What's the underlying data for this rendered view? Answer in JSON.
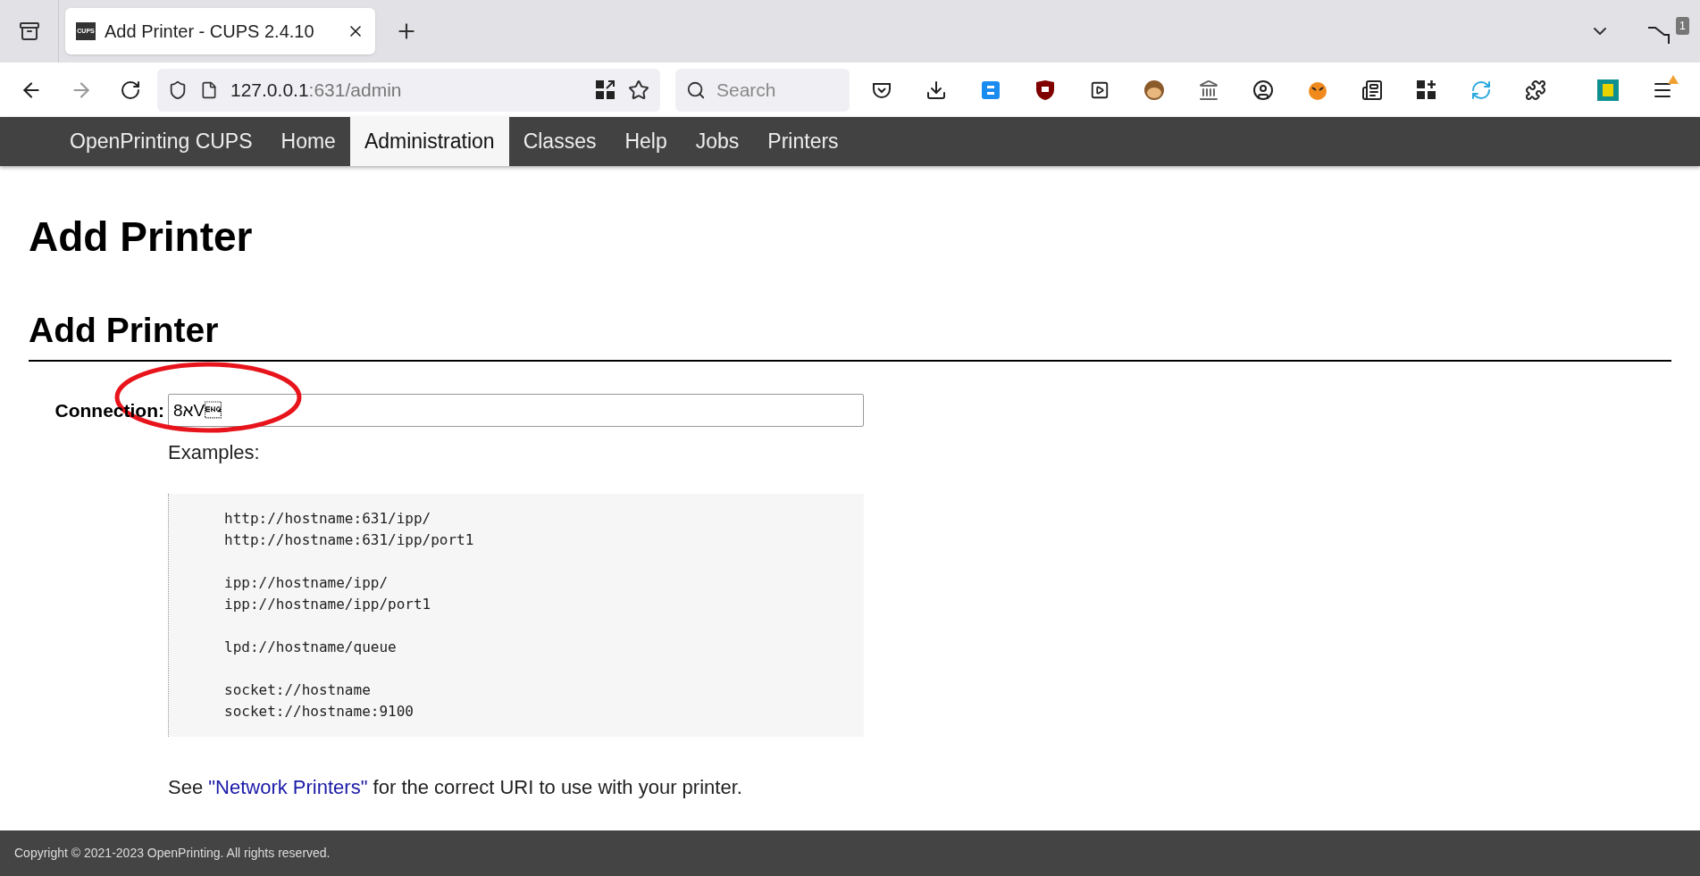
{
  "browser": {
    "tab": {
      "favicon_label": "CUPS",
      "title": "Add Printer - CUPS 2.4.10"
    },
    "address": {
      "host": "127.0.0.1",
      "path": ":631/admin"
    },
    "search": {
      "placeholder": "Search"
    },
    "tab_count_badge": "1"
  },
  "nav": [
    {
      "label": "OpenPrinting CUPS",
      "selected": false
    },
    {
      "label": "Home",
      "selected": false
    },
    {
      "label": "Administration",
      "selected": true
    },
    {
      "label": "Classes",
      "selected": false
    },
    {
      "label": "Help",
      "selected": false
    },
    {
      "label": "Jobs",
      "selected": false
    },
    {
      "label": "Printers",
      "selected": false
    }
  ],
  "page": {
    "title": "Add Printer",
    "section_title": "Add Printer",
    "connection": {
      "label": "Connection:",
      "value": "8אV\u0005"
    },
    "examples_label": "Examples:",
    "examples": "http://hostname:631/ipp/\nhttp://hostname:631/ipp/port1\n\nipp://hostname/ipp/\nipp://hostname/ipp/port1\n\nlpd://hostname/queue\n\nsocket://hostname\nsocket://hostname:9100",
    "note": {
      "before": "See ",
      "link": "\"Network Printers\"",
      "after": " for the correct URI to use with your printer."
    }
  },
  "footer": "Copyright © 2021-2023 OpenPrinting. All rights reserved."
}
